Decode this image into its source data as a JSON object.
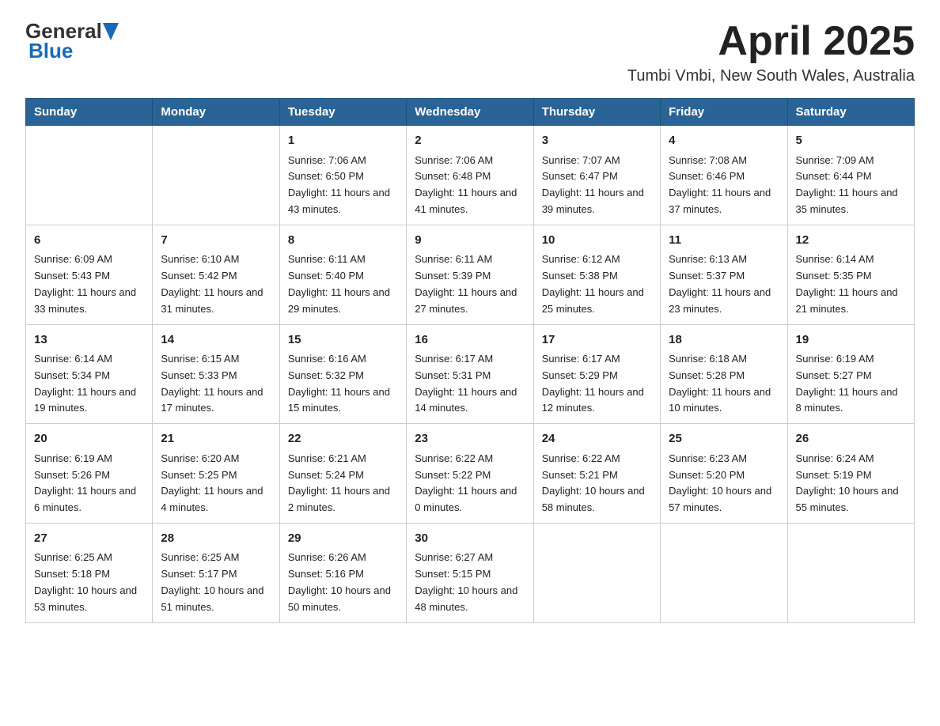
{
  "header": {
    "logo_general": "General",
    "logo_blue": "Blue",
    "month_title": "April 2025",
    "location": "Tumbi Vmbi, New South Wales, Australia"
  },
  "weekdays": [
    "Sunday",
    "Monday",
    "Tuesday",
    "Wednesday",
    "Thursday",
    "Friday",
    "Saturday"
  ],
  "weeks": [
    [
      {
        "day": "",
        "sunrise": "",
        "sunset": "",
        "daylight": ""
      },
      {
        "day": "",
        "sunrise": "",
        "sunset": "",
        "daylight": ""
      },
      {
        "day": "1",
        "sunrise": "Sunrise: 7:06 AM",
        "sunset": "Sunset: 6:50 PM",
        "daylight": "Daylight: 11 hours and 43 minutes."
      },
      {
        "day": "2",
        "sunrise": "Sunrise: 7:06 AM",
        "sunset": "Sunset: 6:48 PM",
        "daylight": "Daylight: 11 hours and 41 minutes."
      },
      {
        "day": "3",
        "sunrise": "Sunrise: 7:07 AM",
        "sunset": "Sunset: 6:47 PM",
        "daylight": "Daylight: 11 hours and 39 minutes."
      },
      {
        "day": "4",
        "sunrise": "Sunrise: 7:08 AM",
        "sunset": "Sunset: 6:46 PM",
        "daylight": "Daylight: 11 hours and 37 minutes."
      },
      {
        "day": "5",
        "sunrise": "Sunrise: 7:09 AM",
        "sunset": "Sunset: 6:44 PM",
        "daylight": "Daylight: 11 hours and 35 minutes."
      }
    ],
    [
      {
        "day": "6",
        "sunrise": "Sunrise: 6:09 AM",
        "sunset": "Sunset: 5:43 PM",
        "daylight": "Daylight: 11 hours and 33 minutes."
      },
      {
        "day": "7",
        "sunrise": "Sunrise: 6:10 AM",
        "sunset": "Sunset: 5:42 PM",
        "daylight": "Daylight: 11 hours and 31 minutes."
      },
      {
        "day": "8",
        "sunrise": "Sunrise: 6:11 AM",
        "sunset": "Sunset: 5:40 PM",
        "daylight": "Daylight: 11 hours and 29 minutes."
      },
      {
        "day": "9",
        "sunrise": "Sunrise: 6:11 AM",
        "sunset": "Sunset: 5:39 PM",
        "daylight": "Daylight: 11 hours and 27 minutes."
      },
      {
        "day": "10",
        "sunrise": "Sunrise: 6:12 AM",
        "sunset": "Sunset: 5:38 PM",
        "daylight": "Daylight: 11 hours and 25 minutes."
      },
      {
        "day": "11",
        "sunrise": "Sunrise: 6:13 AM",
        "sunset": "Sunset: 5:37 PM",
        "daylight": "Daylight: 11 hours and 23 minutes."
      },
      {
        "day": "12",
        "sunrise": "Sunrise: 6:14 AM",
        "sunset": "Sunset: 5:35 PM",
        "daylight": "Daylight: 11 hours and 21 minutes."
      }
    ],
    [
      {
        "day": "13",
        "sunrise": "Sunrise: 6:14 AM",
        "sunset": "Sunset: 5:34 PM",
        "daylight": "Daylight: 11 hours and 19 minutes."
      },
      {
        "day": "14",
        "sunrise": "Sunrise: 6:15 AM",
        "sunset": "Sunset: 5:33 PM",
        "daylight": "Daylight: 11 hours and 17 minutes."
      },
      {
        "day": "15",
        "sunrise": "Sunrise: 6:16 AM",
        "sunset": "Sunset: 5:32 PM",
        "daylight": "Daylight: 11 hours and 15 minutes."
      },
      {
        "day": "16",
        "sunrise": "Sunrise: 6:17 AM",
        "sunset": "Sunset: 5:31 PM",
        "daylight": "Daylight: 11 hours and 14 minutes."
      },
      {
        "day": "17",
        "sunrise": "Sunrise: 6:17 AM",
        "sunset": "Sunset: 5:29 PM",
        "daylight": "Daylight: 11 hours and 12 minutes."
      },
      {
        "day": "18",
        "sunrise": "Sunrise: 6:18 AM",
        "sunset": "Sunset: 5:28 PM",
        "daylight": "Daylight: 11 hours and 10 minutes."
      },
      {
        "day": "19",
        "sunrise": "Sunrise: 6:19 AM",
        "sunset": "Sunset: 5:27 PM",
        "daylight": "Daylight: 11 hours and 8 minutes."
      }
    ],
    [
      {
        "day": "20",
        "sunrise": "Sunrise: 6:19 AM",
        "sunset": "Sunset: 5:26 PM",
        "daylight": "Daylight: 11 hours and 6 minutes."
      },
      {
        "day": "21",
        "sunrise": "Sunrise: 6:20 AM",
        "sunset": "Sunset: 5:25 PM",
        "daylight": "Daylight: 11 hours and 4 minutes."
      },
      {
        "day": "22",
        "sunrise": "Sunrise: 6:21 AM",
        "sunset": "Sunset: 5:24 PM",
        "daylight": "Daylight: 11 hours and 2 minutes."
      },
      {
        "day": "23",
        "sunrise": "Sunrise: 6:22 AM",
        "sunset": "Sunset: 5:22 PM",
        "daylight": "Daylight: 11 hours and 0 minutes."
      },
      {
        "day": "24",
        "sunrise": "Sunrise: 6:22 AM",
        "sunset": "Sunset: 5:21 PM",
        "daylight": "Daylight: 10 hours and 58 minutes."
      },
      {
        "day": "25",
        "sunrise": "Sunrise: 6:23 AM",
        "sunset": "Sunset: 5:20 PM",
        "daylight": "Daylight: 10 hours and 57 minutes."
      },
      {
        "day": "26",
        "sunrise": "Sunrise: 6:24 AM",
        "sunset": "Sunset: 5:19 PM",
        "daylight": "Daylight: 10 hours and 55 minutes."
      }
    ],
    [
      {
        "day": "27",
        "sunrise": "Sunrise: 6:25 AM",
        "sunset": "Sunset: 5:18 PM",
        "daylight": "Daylight: 10 hours and 53 minutes."
      },
      {
        "day": "28",
        "sunrise": "Sunrise: 6:25 AM",
        "sunset": "Sunset: 5:17 PM",
        "daylight": "Daylight: 10 hours and 51 minutes."
      },
      {
        "day": "29",
        "sunrise": "Sunrise: 6:26 AM",
        "sunset": "Sunset: 5:16 PM",
        "daylight": "Daylight: 10 hours and 50 minutes."
      },
      {
        "day": "30",
        "sunrise": "Sunrise: 6:27 AM",
        "sunset": "Sunset: 5:15 PM",
        "daylight": "Daylight: 10 hours and 48 minutes."
      },
      {
        "day": "",
        "sunrise": "",
        "sunset": "",
        "daylight": ""
      },
      {
        "day": "",
        "sunrise": "",
        "sunset": "",
        "daylight": ""
      },
      {
        "day": "",
        "sunrise": "",
        "sunset": "",
        "daylight": ""
      }
    ]
  ]
}
